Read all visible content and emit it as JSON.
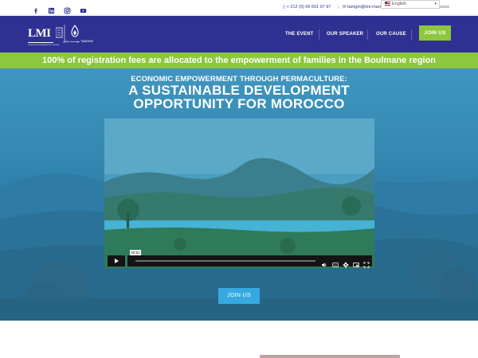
{
  "topbar": {
    "social_icons": [
      "facebook-icon",
      "linkedin-icon",
      "instagram-icon",
      "youtube-icon"
    ],
    "phone": "+ 212 (0) 66 601 97 97",
    "email": "tamgin@lmi-maroc.ma",
    "location_partial": "Boulmane, Morocco",
    "language": "English"
  },
  "nav": {
    "logo_text": "LMI",
    "logo_subtext": "Leadership & Management Institute",
    "logo_arabic": "مؤسسة تمكين",
    "logo_latin": "TAMGINE",
    "items": [
      {
        "label": "THE EVENT"
      },
      {
        "label": "OUR SPEAKER"
      },
      {
        "label": "OUR CAUSE"
      }
    ],
    "join_label": "JOIN US"
  },
  "banner": {
    "text": "100% of registration fees are allocated to the empowerment of families in the Boulmane region"
  },
  "hero": {
    "subtitle": "ECONOMIC EMPOWERMENT THROUGH PERMACULTURE:",
    "title_line1": "A SUSTAINABLE DEVELOPMENT",
    "title_line2": "OPPORTUNITY FOR MOROCCO",
    "video": {
      "time": "00:51",
      "play_icon": "play-icon",
      "control_icons": [
        "volume-icon",
        "captions-icon",
        "settings-icon",
        "pip-icon",
        "fullscreen-icon"
      ]
    },
    "join_label": "JOIN US"
  },
  "colors": {
    "brand_blue": "#2e3192",
    "green": "#8dc63f",
    "cta_blue": "#36a9e0"
  }
}
